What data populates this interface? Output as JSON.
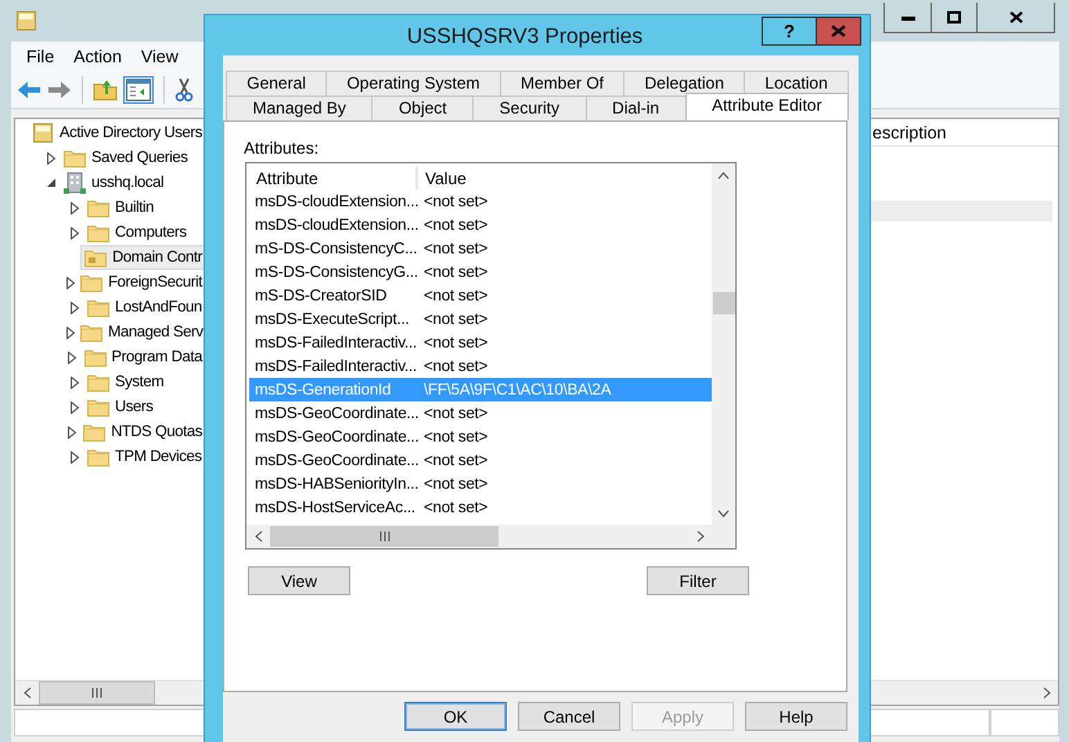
{
  "main_window": {
    "menu": [
      "File",
      "Action",
      "View"
    ],
    "tree": {
      "label": "Active Directory Users",
      "kind": "root",
      "selected": false,
      "children": [
        {
          "label": "Saved Queries",
          "kind": "folder",
          "expanded": false,
          "selected": false
        },
        {
          "label": "usshq.local",
          "kind": "domain",
          "expanded": true,
          "selected": false,
          "children": [
            {
              "label": "Builtin",
              "kind": "folder",
              "expanded": false,
              "selected": false
            },
            {
              "label": "Computers",
              "kind": "folder",
              "expanded": false,
              "selected": false
            },
            {
              "label": "Domain Contr",
              "kind": "ou",
              "selected": true
            },
            {
              "label": "ForeignSecurit",
              "kind": "folder",
              "expanded": false,
              "selected": false
            },
            {
              "label": "LostAndFoun",
              "kind": "folder",
              "expanded": false,
              "selected": false
            },
            {
              "label": "Managed Serv",
              "kind": "folder",
              "expanded": false,
              "selected": false
            },
            {
              "label": "Program Data",
              "kind": "folder",
              "expanded": false,
              "selected": false
            },
            {
              "label": "System",
              "kind": "folder",
              "expanded": false,
              "selected": false
            },
            {
              "label": "Users",
              "kind": "folder",
              "expanded": false,
              "selected": false
            },
            {
              "label": "NTDS Quotas",
              "kind": "folder",
              "expanded": false,
              "selected": false
            },
            {
              "label": "TPM Devices",
              "kind": "folder",
              "expanded": false,
              "selected": false
            }
          ]
        }
      ]
    },
    "list_columns": [
      "escription"
    ]
  },
  "dialog": {
    "title": "USSHQSRV3 Properties",
    "help": "?",
    "tab_rows": [
      [
        {
          "label": "General",
          "selected": false
        },
        {
          "label": "Operating System",
          "selected": false
        },
        {
          "label": "Member Of",
          "selected": false
        },
        {
          "label": "Delegation",
          "selected": false
        },
        {
          "label": "Location",
          "selected": false
        }
      ],
      [
        {
          "label": "Managed By",
          "selected": false
        },
        {
          "label": "Object",
          "selected": false
        },
        {
          "label": "Security",
          "selected": false
        },
        {
          "label": "Dial-in",
          "selected": false
        },
        {
          "label": "Attribute Editor",
          "selected": true
        }
      ]
    ],
    "attributes_label": "Attributes:",
    "columns": [
      "Attribute",
      "Value"
    ],
    "rows": [
      {
        "attribute": "msDS-cloudExtension...",
        "value": "<not set>",
        "selected": false
      },
      {
        "attribute": "msDS-cloudExtension...",
        "value": "<not set>",
        "selected": false
      },
      {
        "attribute": "mS-DS-ConsistencyC...",
        "value": "<not set>",
        "selected": false
      },
      {
        "attribute": "mS-DS-ConsistencyG...",
        "value": "<not set>",
        "selected": false
      },
      {
        "attribute": "mS-DS-CreatorSID",
        "value": "<not set>",
        "selected": false
      },
      {
        "attribute": "msDS-ExecuteScript...",
        "value": "<not set>",
        "selected": false
      },
      {
        "attribute": "msDS-FailedInteractiv...",
        "value": "<not set>",
        "selected": false
      },
      {
        "attribute": "msDS-FailedInteractiv...",
        "value": "<not set>",
        "selected": false
      },
      {
        "attribute": "msDS-GenerationId",
        "value": "\\FF\\5A\\9F\\C1\\AC\\10\\BA\\2A",
        "selected": true
      },
      {
        "attribute": "msDS-GeoCoordinate...",
        "value": "<not set>",
        "selected": false
      },
      {
        "attribute": "msDS-GeoCoordinate...",
        "value": "<not set>",
        "selected": false
      },
      {
        "attribute": "msDS-GeoCoordinate...",
        "value": "<not set>",
        "selected": false
      },
      {
        "attribute": "msDS-HABSeniorityIn...",
        "value": "<not set>",
        "selected": false
      },
      {
        "attribute": "msDS-HostServiceAc...",
        "value": "<not set>",
        "selected": false
      }
    ],
    "list_buttons": [
      "View",
      "Filter"
    ],
    "buttons": [
      {
        "label": "OK",
        "default": true,
        "disabled": false
      },
      {
        "label": "Cancel",
        "default": false,
        "disabled": false
      },
      {
        "label": "Apply",
        "default": false,
        "disabled": true
      },
      {
        "label": "Help",
        "default": false,
        "disabled": false
      }
    ]
  }
}
